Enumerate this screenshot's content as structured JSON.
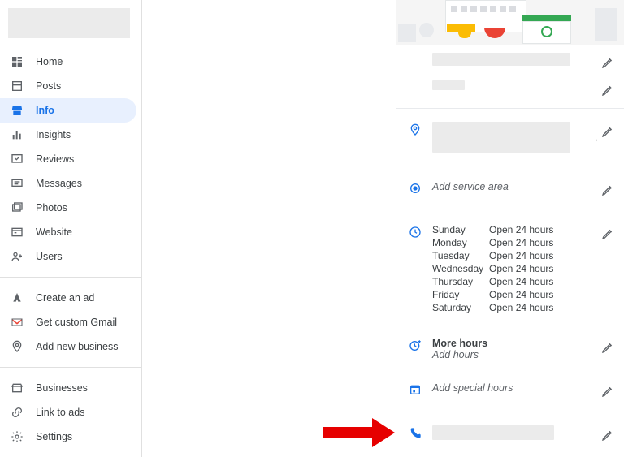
{
  "sidebar": {
    "nav_primary": [
      {
        "label": "Home",
        "icon": "dashboard-icon"
      },
      {
        "label": "Posts",
        "icon": "posts-icon"
      },
      {
        "label": "Info",
        "icon": "storefront-icon",
        "active": true
      },
      {
        "label": "Insights",
        "icon": "insights-icon"
      },
      {
        "label": "Reviews",
        "icon": "reviews-icon"
      },
      {
        "label": "Messages",
        "icon": "messages-icon"
      },
      {
        "label": "Photos",
        "icon": "photos-icon"
      },
      {
        "label": "Website",
        "icon": "website-icon"
      },
      {
        "label": "Users",
        "icon": "users-icon"
      }
    ],
    "nav_secondary": [
      {
        "label": "Create an ad",
        "icon": "ads-icon"
      },
      {
        "label": "Get custom Gmail",
        "icon": "gmail-icon"
      },
      {
        "label": "Add new business",
        "icon": "add-location-icon"
      }
    ],
    "nav_tertiary": [
      {
        "label": "Businesses",
        "icon": "businesses-icon"
      },
      {
        "label": "Link to ads",
        "icon": "link-icon"
      },
      {
        "label": "Settings",
        "icon": "settings-icon"
      }
    ]
  },
  "info_panel": {
    "service_area_label": "Add service area",
    "hours": {
      "days": [
        {
          "day": "Sunday",
          "value": "Open 24 hours"
        },
        {
          "day": "Monday",
          "value": "Open 24 hours"
        },
        {
          "day": "Tuesday",
          "value": "Open 24 hours"
        },
        {
          "day": "Wednesday",
          "value": "Open 24 hours"
        },
        {
          "day": "Thursday",
          "value": "Open 24 hours"
        },
        {
          "day": "Friday",
          "value": "Open 24 hours"
        },
        {
          "day": "Saturday",
          "value": "Open 24 hours"
        }
      ]
    },
    "more_hours_label": "More hours",
    "add_hours_label": "Add hours",
    "special_hours_label": "Add special hours",
    "address_trailing": ","
  }
}
